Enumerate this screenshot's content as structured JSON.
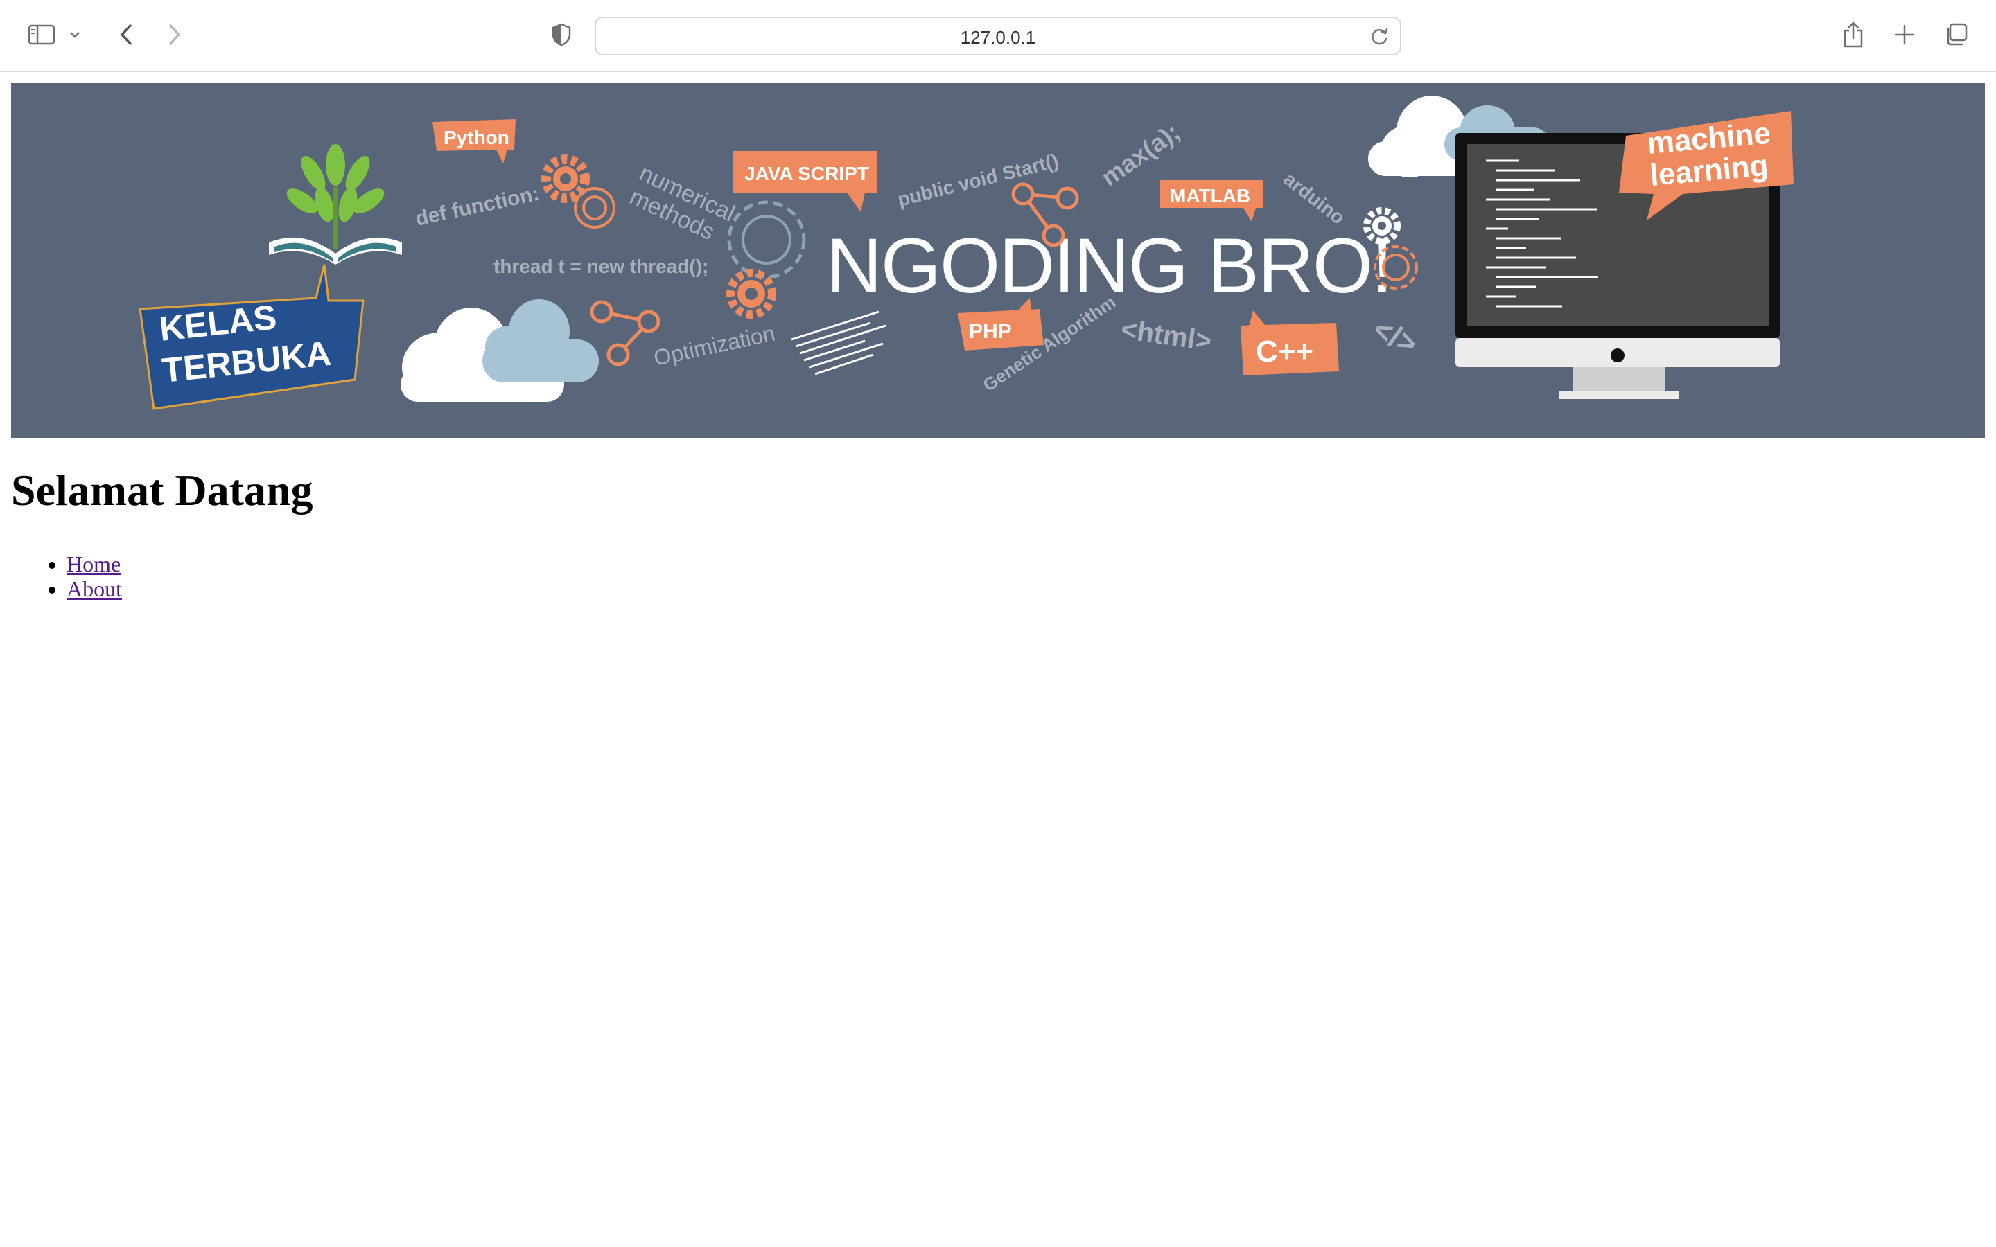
{
  "browser": {
    "url": "127.0.0.1",
    "icons": [
      "sidebar-icon",
      "chevron-down-icon",
      "back-icon",
      "forward-icon",
      "shield-icon",
      "reload-icon",
      "share-icon",
      "new-tab-icon",
      "tabs-overview-icon"
    ]
  },
  "banner": {
    "headline": "NGODING BRO!",
    "badge": "KELAS TERBUKA",
    "badge_line1": "KELAS",
    "badge_line2": "TERBUKA",
    "tags": {
      "python": "Python",
      "javascript": "JAVA SCRIPT",
      "matlab": "MATLAB",
      "php": "PHP",
      "cpp": "C++",
      "ml_line1": "machine",
      "ml_line2": "learning"
    },
    "snippets": {
      "def_function": "def function:",
      "numerical_line1": "numerical",
      "numerical_line2": "methods",
      "thread": "thread t = new thread();",
      "public_void": "public void Start()",
      "max": "max(a);",
      "arduino": "arduino",
      "optimization": "Optimization",
      "genetic": "Genetic Algorithm",
      "html": "<html>",
      "slash_tag": "</>"
    },
    "colors": {
      "background": "#596578",
      "accent_orange": "#ef8a5e",
      "badge_blue": "#25508f",
      "leaf_green": "#7dc242",
      "cloud_blue": "#a7c3d6"
    }
  },
  "page": {
    "title": "Selamat Datang",
    "nav": [
      {
        "label": "Home"
      },
      {
        "label": "About"
      }
    ],
    "link_color": "#551a8b"
  }
}
